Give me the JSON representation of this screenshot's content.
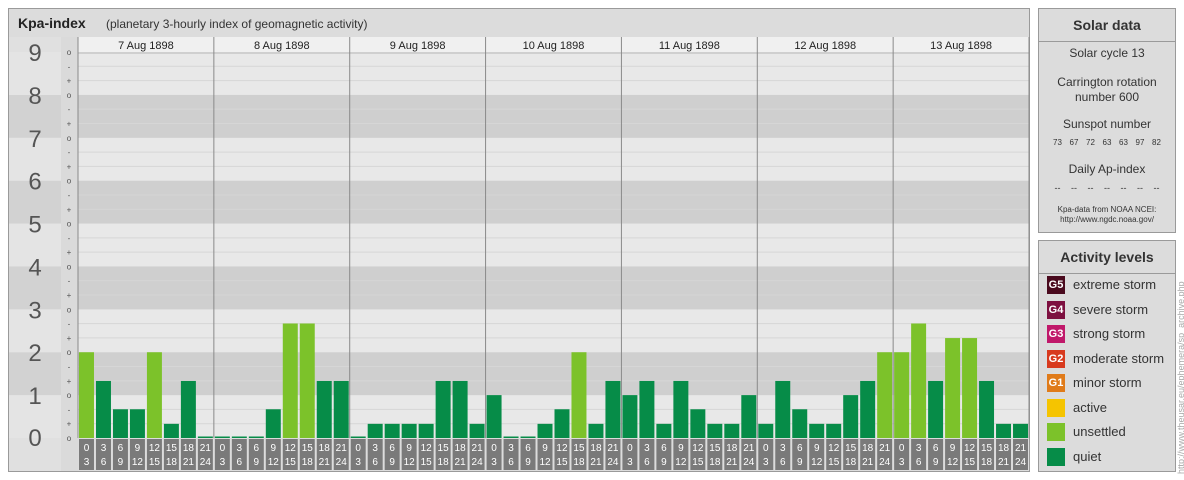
{
  "header": {
    "title": "Kpa-index",
    "subtitle": "(planetary 3-hourly index of geomagnetic activity)"
  },
  "solar": {
    "title": "Solar data",
    "cycle": "Solar cycle 13",
    "rotation_line1": "Carrington rotation",
    "rotation_line2": "number 600",
    "sunspot_title": "Sunspot number",
    "sunspots": [
      "73",
      "67",
      "72",
      "63",
      "63",
      "97",
      "82"
    ],
    "ap_title": "Daily Ap-index",
    "ap_values": [
      "--",
      "--",
      "--",
      "--",
      "--",
      "--",
      "--"
    ],
    "source_line1": "Kpa-data from NOAA NCEI:",
    "source_line2": "http://www.ngdc.noaa.gov/"
  },
  "activity": {
    "title": "Activity levels",
    "levels": [
      {
        "code": "G5",
        "label": "extreme storm",
        "color": "#4a0a1e"
      },
      {
        "code": "G4",
        "label": "severe storm",
        "color": "#7d1040"
      },
      {
        "code": "G3",
        "label": "strong storm",
        "color": "#c0186a"
      },
      {
        "code": "G2",
        "label": "moderate storm",
        "color": "#d83a1e"
      },
      {
        "code": "G1",
        "label": "minor storm",
        "color": "#e07b1a"
      },
      {
        "code": "",
        "label": "active",
        "color": "#f5c400"
      },
      {
        "code": "",
        "label": "unsettled",
        "color": "#7cc22a"
      },
      {
        "code": "",
        "label": "quiet",
        "color": "#068c48"
      }
    ]
  },
  "credit": "http://www.theusar.eu/ephemera/sp_archive.php",
  "chart_data": {
    "type": "bar",
    "title": "Kpa-index",
    "ylim": [
      0,
      9
    ],
    "y_ticks": [
      "0",
      "1",
      "2",
      "3",
      "4",
      "5",
      "6",
      "7",
      "8",
      "9"
    ],
    "minor_marks": [
      "+",
      "o",
      "-"
    ],
    "days": [
      "7 Aug 1898",
      "8 Aug 1898",
      "9 Aug 1898",
      "10 Aug 1898",
      "11 Aug 1898",
      "12 Aug 1898",
      "13 Aug 1898"
    ],
    "intervals": [
      [
        "0",
        "3"
      ],
      [
        "3",
        "6"
      ],
      [
        "6",
        "9"
      ],
      [
        "9",
        "12"
      ],
      [
        "12",
        "15"
      ],
      [
        "15",
        "18"
      ],
      [
        "18",
        "21"
      ],
      [
        "21",
        "24"
      ]
    ],
    "colors": {
      "quiet": "#068c48",
      "unsettled": "#7cc22a"
    },
    "values": [
      [
        2,
        1.33,
        0.67,
        0.67,
        2,
        0.33,
        1.33,
        0
      ],
      [
        0,
        0,
        0,
        0.67,
        2.67,
        2.67,
        1.33,
        1.33
      ],
      [
        0,
        0.33,
        0.33,
        0.33,
        0.33,
        1.33,
        1.33,
        0.33
      ],
      [
        1,
        0,
        0,
        0.33,
        0.67,
        2,
        0.33,
        1.33
      ],
      [
        1,
        1.33,
        0.33,
        1.33,
        0.67,
        0.33,
        0.33,
        1
      ],
      [
        0.33,
        1.33,
        0.67,
        0.33,
        0.33,
        1,
        1.33,
        2
      ],
      [
        2,
        2.67,
        1.33,
        2.33,
        2.33,
        1.33,
        0.33,
        0.33
      ]
    ]
  }
}
